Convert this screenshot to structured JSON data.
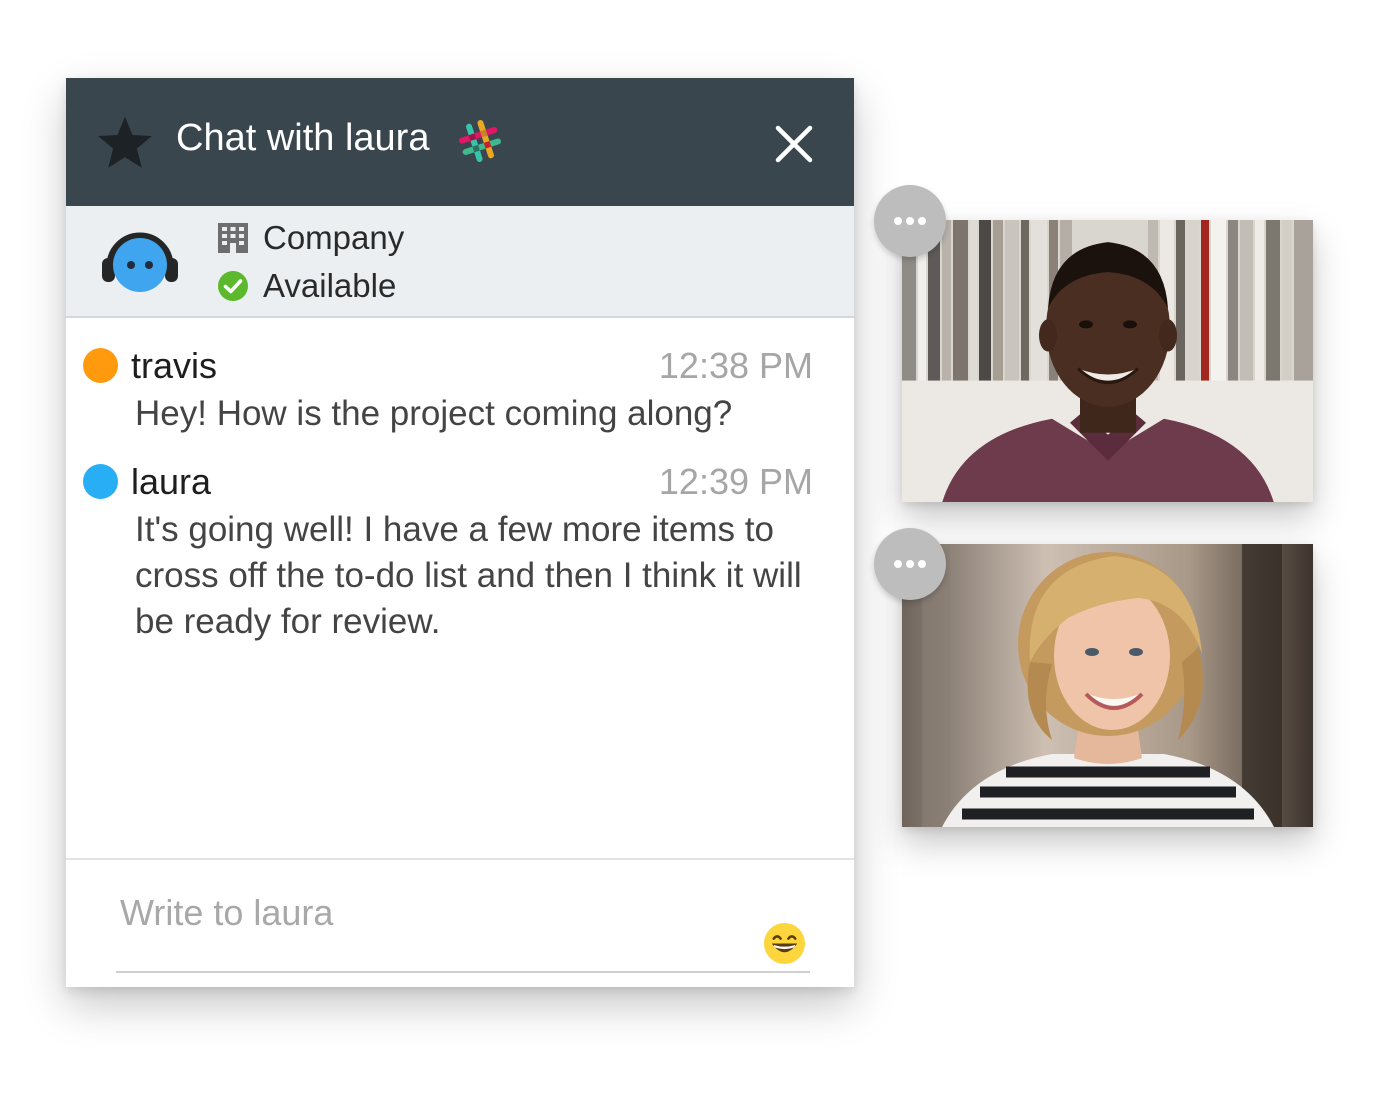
{
  "chat": {
    "title": "Chat with laura",
    "icons": {
      "favorite": "star-icon",
      "integration": "slack-icon",
      "close": "close-icon"
    },
    "contact": {
      "avatar": "bot-avatar-icon",
      "company": "Company",
      "company_icon": "building-icon",
      "status": "Available",
      "status_icon": "check-circle-icon",
      "status_color": "#5cb82d"
    },
    "messages": [
      {
        "sender": "travis",
        "time": "12:38 PM",
        "text": "Hey! How is the project coming along?",
        "color": "#ff9a0f"
      },
      {
        "sender": "laura",
        "time": "12:39 PM",
        "text": "It's going well! I have a few more items to cross off the to-do list and then I think it will be ready for review.",
        "color": "#27aef5"
      }
    ],
    "compose": {
      "placeholder": "Write to laura",
      "value": "",
      "emoji_icon": "grinning-emoji-icon"
    }
  },
  "video_tiles": [
    {
      "feed": "video-feed-man",
      "menu_icon": "more-horizontal-icon"
    },
    {
      "feed": "video-feed-woman",
      "menu_icon": "more-horizontal-icon"
    }
  ],
  "colors": {
    "header_bg": "#3a464e",
    "contact_bar_bg": "#eceff2",
    "accent_orange": "#ff9a0f",
    "accent_blue": "#27aef5",
    "status_green": "#5cb82d"
  }
}
